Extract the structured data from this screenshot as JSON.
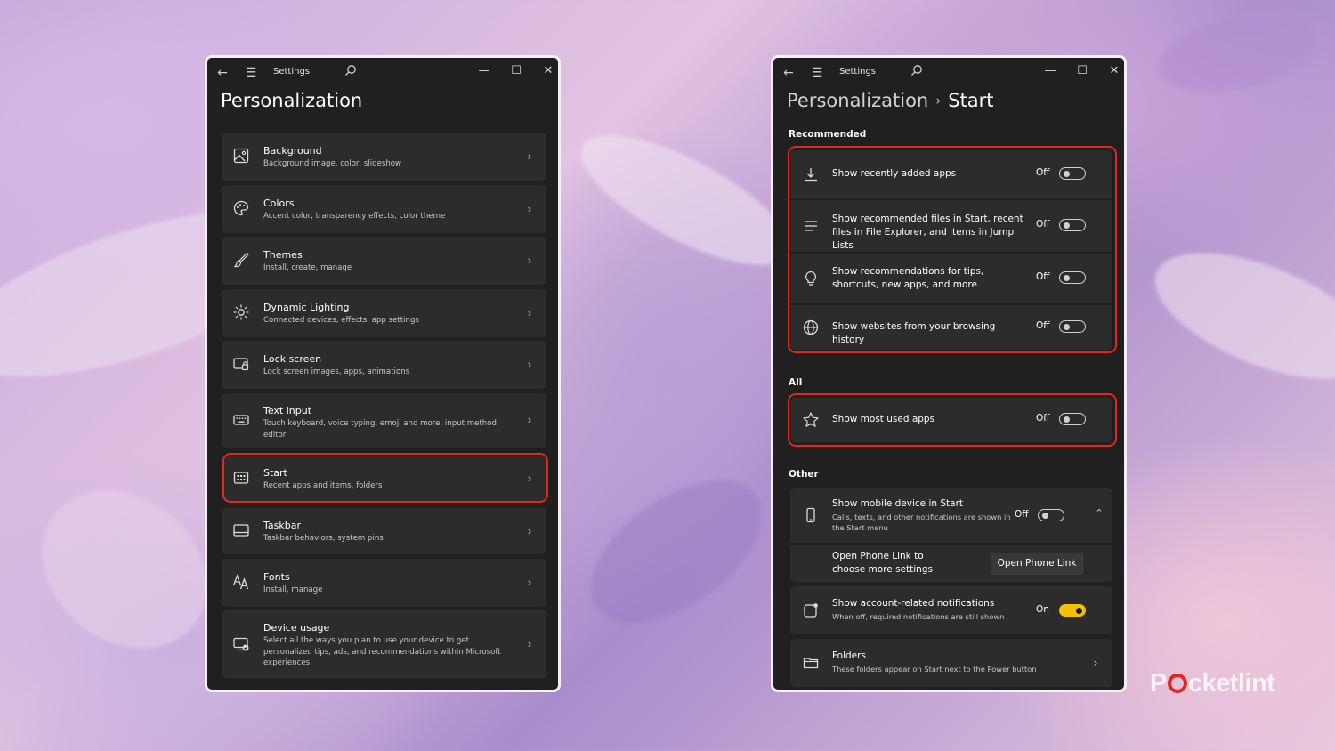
{
  "left_window": {
    "title": "Settings",
    "page_title": "Personalization",
    "items": [
      {
        "title": "Background",
        "subtitle": "Background image, color, slideshow",
        "icon": "image-icon"
      },
      {
        "title": "Colors",
        "subtitle": "Accent color, transparency effects, color theme",
        "icon": "palette-icon"
      },
      {
        "title": "Themes",
        "subtitle": "Install, create, manage",
        "icon": "brush-icon"
      },
      {
        "title": "Dynamic Lighting",
        "subtitle": "Connected devices, effects, app settings",
        "icon": "lighting-icon"
      },
      {
        "title": "Lock screen",
        "subtitle": "Lock screen images, apps, animations",
        "icon": "lock-screen-icon"
      },
      {
        "title": "Text input",
        "subtitle": "Touch keyboard, voice typing, emoji and more, input method editor",
        "icon": "keyboard-icon"
      },
      {
        "title": "Start",
        "subtitle": "Recent apps and items, folders",
        "icon": "start-icon",
        "highlighted": true
      },
      {
        "title": "Taskbar",
        "subtitle": "Taskbar behaviors, system pins",
        "icon": "taskbar-icon"
      },
      {
        "title": "Fonts",
        "subtitle": "Install, manage",
        "icon": "fonts-icon"
      },
      {
        "title": "Device usage",
        "subtitle": "Select all the ways you plan to use your device to get personalized tips, ads, and recommendations within Microsoft experiences.",
        "icon": "device-usage-icon"
      }
    ]
  },
  "right_window": {
    "title": "Settings",
    "breadcrumb_parent": "Personalization",
    "breadcrumb_separator": "›",
    "breadcrumb_current": "Start",
    "recommended_label": "Recommended",
    "recommended": [
      {
        "label": "Show recently added apps",
        "state": "Off",
        "icon": "download-icon"
      },
      {
        "label": "Show recommended files in Start, recent files in File Explorer, and items in Jump Lists",
        "state": "Off",
        "icon": "list-icon"
      },
      {
        "label": "Show recommendations for tips, shortcuts, new apps, and more",
        "state": "Off",
        "icon": "lightbulb-icon"
      },
      {
        "label": "Show websites from your browsing history",
        "state": "Off",
        "icon": "globe-icon"
      }
    ],
    "all_label": "All",
    "all": [
      {
        "label": "Show most used apps",
        "state": "Off",
        "icon": "star-icon"
      }
    ],
    "other_label": "Other",
    "mobile": {
      "title": "Show mobile device in Start",
      "subtitle": "Calls, texts, and other notifications are shown in the Start menu",
      "state": "Off",
      "icon": "phone-icon"
    },
    "phone_link": {
      "text": "Open Phone Link to choose more settings",
      "button": "Open Phone Link"
    },
    "account": {
      "title": "Show account-related notifications",
      "subtitle": "When off, required notifications are still shown",
      "state": "On",
      "icon": "account-notification-icon"
    },
    "folders": {
      "title": "Folders",
      "subtitle": "These folders appear on Start next to the Power button",
      "icon": "folder-icon"
    }
  },
  "colors": {
    "highlight": "#e0281e",
    "toggle_on": "#f2c100",
    "window_bg": "#202020",
    "card_bg": "#2c2c2c"
  },
  "watermark": {
    "before": "P",
    "after": "cketlint"
  }
}
